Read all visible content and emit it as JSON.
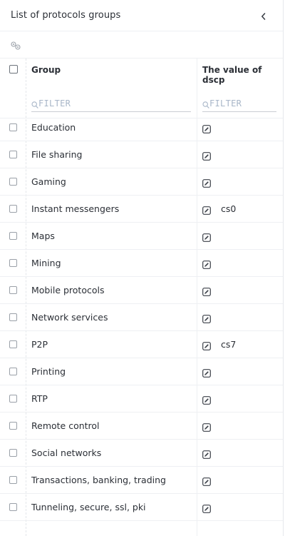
{
  "header": {
    "title": "List of protocols groups"
  },
  "table": {
    "columns": {
      "group": "Group",
      "dscp": "The value of dscp"
    },
    "filter_placeholder": "FILTER",
    "rows": [
      {
        "group": "Education",
        "dscp": ""
      },
      {
        "group": "File sharing",
        "dscp": ""
      },
      {
        "group": "Gaming",
        "dscp": ""
      },
      {
        "group": "Instant messengers",
        "dscp": "cs0"
      },
      {
        "group": "Maps",
        "dscp": ""
      },
      {
        "group": "Mining",
        "dscp": ""
      },
      {
        "group": "Mobile protocols",
        "dscp": ""
      },
      {
        "group": "Network services",
        "dscp": ""
      },
      {
        "group": "P2P",
        "dscp": "cs7"
      },
      {
        "group": "Printing",
        "dscp": ""
      },
      {
        "group": "RTP",
        "dscp": ""
      },
      {
        "group": "Remote control",
        "dscp": ""
      },
      {
        "group": "Social networks",
        "dscp": ""
      },
      {
        "group": "Transactions, banking, trading",
        "dscp": ""
      },
      {
        "group": "Tunneling, secure, ssl, pki",
        "dscp": ""
      }
    ]
  },
  "icons": {
    "collapse": "chevron-left-icon",
    "settings": "gears-icon",
    "search": "magnifier-icon",
    "edit": "edit-icon"
  },
  "colors": {
    "text": "#2b2f36",
    "placeholder": "#a8b6c8",
    "border": "#eef0f3"
  }
}
